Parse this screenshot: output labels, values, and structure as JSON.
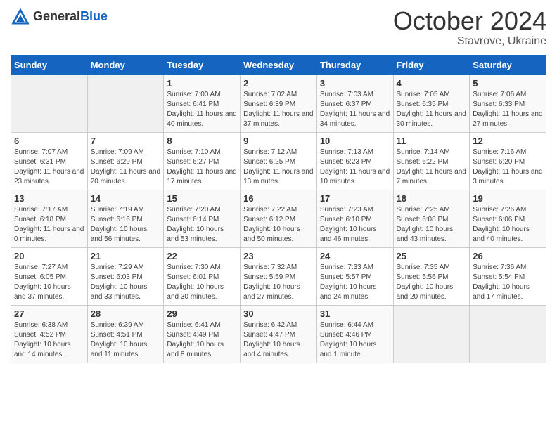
{
  "header": {
    "logo_general": "General",
    "logo_blue": "Blue",
    "month": "October 2024",
    "location": "Stavrove, Ukraine"
  },
  "days_of_week": [
    "Sunday",
    "Monday",
    "Tuesday",
    "Wednesday",
    "Thursday",
    "Friday",
    "Saturday"
  ],
  "weeks": [
    [
      {
        "day": "",
        "info": ""
      },
      {
        "day": "",
        "info": ""
      },
      {
        "day": "1",
        "info": "Sunrise: 7:00 AM\nSunset: 6:41 PM\nDaylight: 11 hours and 40 minutes."
      },
      {
        "day": "2",
        "info": "Sunrise: 7:02 AM\nSunset: 6:39 PM\nDaylight: 11 hours and 37 minutes."
      },
      {
        "day": "3",
        "info": "Sunrise: 7:03 AM\nSunset: 6:37 PM\nDaylight: 11 hours and 34 minutes."
      },
      {
        "day": "4",
        "info": "Sunrise: 7:05 AM\nSunset: 6:35 PM\nDaylight: 11 hours and 30 minutes."
      },
      {
        "day": "5",
        "info": "Sunrise: 7:06 AM\nSunset: 6:33 PM\nDaylight: 11 hours and 27 minutes."
      }
    ],
    [
      {
        "day": "6",
        "info": "Sunrise: 7:07 AM\nSunset: 6:31 PM\nDaylight: 11 hours and 23 minutes."
      },
      {
        "day": "7",
        "info": "Sunrise: 7:09 AM\nSunset: 6:29 PM\nDaylight: 11 hours and 20 minutes."
      },
      {
        "day": "8",
        "info": "Sunrise: 7:10 AM\nSunset: 6:27 PM\nDaylight: 11 hours and 17 minutes."
      },
      {
        "day": "9",
        "info": "Sunrise: 7:12 AM\nSunset: 6:25 PM\nDaylight: 11 hours and 13 minutes."
      },
      {
        "day": "10",
        "info": "Sunrise: 7:13 AM\nSunset: 6:23 PM\nDaylight: 11 hours and 10 minutes."
      },
      {
        "day": "11",
        "info": "Sunrise: 7:14 AM\nSunset: 6:22 PM\nDaylight: 11 hours and 7 minutes."
      },
      {
        "day": "12",
        "info": "Sunrise: 7:16 AM\nSunset: 6:20 PM\nDaylight: 11 hours and 3 minutes."
      }
    ],
    [
      {
        "day": "13",
        "info": "Sunrise: 7:17 AM\nSunset: 6:18 PM\nDaylight: 11 hours and 0 minutes."
      },
      {
        "day": "14",
        "info": "Sunrise: 7:19 AM\nSunset: 6:16 PM\nDaylight: 10 hours and 56 minutes."
      },
      {
        "day": "15",
        "info": "Sunrise: 7:20 AM\nSunset: 6:14 PM\nDaylight: 10 hours and 53 minutes."
      },
      {
        "day": "16",
        "info": "Sunrise: 7:22 AM\nSunset: 6:12 PM\nDaylight: 10 hours and 50 minutes."
      },
      {
        "day": "17",
        "info": "Sunrise: 7:23 AM\nSunset: 6:10 PM\nDaylight: 10 hours and 46 minutes."
      },
      {
        "day": "18",
        "info": "Sunrise: 7:25 AM\nSunset: 6:08 PM\nDaylight: 10 hours and 43 minutes."
      },
      {
        "day": "19",
        "info": "Sunrise: 7:26 AM\nSunset: 6:06 PM\nDaylight: 10 hours and 40 minutes."
      }
    ],
    [
      {
        "day": "20",
        "info": "Sunrise: 7:27 AM\nSunset: 6:05 PM\nDaylight: 10 hours and 37 minutes."
      },
      {
        "day": "21",
        "info": "Sunrise: 7:29 AM\nSunset: 6:03 PM\nDaylight: 10 hours and 33 minutes."
      },
      {
        "day": "22",
        "info": "Sunrise: 7:30 AM\nSunset: 6:01 PM\nDaylight: 10 hours and 30 minutes."
      },
      {
        "day": "23",
        "info": "Sunrise: 7:32 AM\nSunset: 5:59 PM\nDaylight: 10 hours and 27 minutes."
      },
      {
        "day": "24",
        "info": "Sunrise: 7:33 AM\nSunset: 5:57 PM\nDaylight: 10 hours and 24 minutes."
      },
      {
        "day": "25",
        "info": "Sunrise: 7:35 AM\nSunset: 5:56 PM\nDaylight: 10 hours and 20 minutes."
      },
      {
        "day": "26",
        "info": "Sunrise: 7:36 AM\nSunset: 5:54 PM\nDaylight: 10 hours and 17 minutes."
      }
    ],
    [
      {
        "day": "27",
        "info": "Sunrise: 6:38 AM\nSunset: 4:52 PM\nDaylight: 10 hours and 14 minutes."
      },
      {
        "day": "28",
        "info": "Sunrise: 6:39 AM\nSunset: 4:51 PM\nDaylight: 10 hours and 11 minutes."
      },
      {
        "day": "29",
        "info": "Sunrise: 6:41 AM\nSunset: 4:49 PM\nDaylight: 10 hours and 8 minutes."
      },
      {
        "day": "30",
        "info": "Sunrise: 6:42 AM\nSunset: 4:47 PM\nDaylight: 10 hours and 4 minutes."
      },
      {
        "day": "31",
        "info": "Sunrise: 6:44 AM\nSunset: 4:46 PM\nDaylight: 10 hours and 1 minute."
      },
      {
        "day": "",
        "info": ""
      },
      {
        "day": "",
        "info": ""
      }
    ]
  ]
}
